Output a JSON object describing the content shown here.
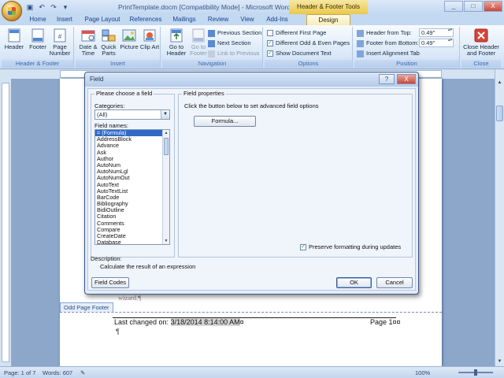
{
  "window": {
    "title": "PrintTemplate.docm [Compatibility Mode] - Microsoft Word",
    "context_tab_title": "Header & Footer Tools",
    "controls": [
      "_",
      "□",
      "X"
    ]
  },
  "tabs": [
    "Home",
    "Insert",
    "Page Layout",
    "References",
    "Mailings",
    "Review",
    "View",
    "Add-Ins",
    "Design"
  ],
  "active_tab": "Design",
  "ribbon": {
    "header_footer": {
      "label": "Header & Footer",
      "header": "Header",
      "footer": "Footer",
      "page_number": "Page Number"
    },
    "insert": {
      "label": "Insert",
      "date_time": "Date & Time",
      "quick_parts": "Quick Parts",
      "picture": "Picture",
      "clip_art": "Clip Art"
    },
    "navigation": {
      "label": "Navigation",
      "goto_header": "Go to Header",
      "goto_footer": "Go to Footer",
      "previous_section": "Previous Section",
      "next_section": "Next Section",
      "link_to_previous": "Link to Previous"
    },
    "options": {
      "label": "Options",
      "different_first_page": "Different First Page",
      "different_odd_even": "Different Odd & Even Pages",
      "show_document_text": "Show Document Text",
      "different_first_page_checked": false,
      "different_odd_even_checked": true,
      "show_document_text_checked": true
    },
    "position": {
      "label": "Position",
      "header_from_top": "Header from Top:",
      "header_from_top_value": "0.49\"",
      "footer_from_bottom": "Footer from Bottom:",
      "footer_from_bottom_value": "0.49\"",
      "insert_alignment_tab": "Insert Alignment Tab"
    },
    "close": {
      "label": "Close",
      "close_header_footer": "Close Header and Footer"
    }
  },
  "document": {
    "wizard_text": "wizard.¶",
    "odd_page_footer_tab": "Odd Page Footer",
    "footer_left_prefix": "Last changed on: ",
    "footer_left_field": "3/18/2014 8:14:00 AM",
    "footer_left_suffix": "¤",
    "footer_right": "Page 1¤¤",
    "pilcrow": "¶"
  },
  "dialog": {
    "title": "Field",
    "help": "?",
    "close": "X",
    "choose_field": "Please choose a field",
    "categories_label": "Categories:",
    "categories_value": "(All)",
    "field_names_label": "Field names:",
    "field_names": [
      "= (Formula)",
      "AddressBlock",
      "Advance",
      "Ask",
      "Author",
      "AutoNum",
      "AutoNumLgl",
      "AutoNumOut",
      "AutoText",
      "AutoTextList",
      "BarCode",
      "Bibliography",
      "BidiOutline",
      "Citation",
      "Comments",
      "Compare",
      "CreateDate",
      "Database"
    ],
    "selected_field": "= (Formula)",
    "field_properties": "Field properties",
    "properties_hint": "Click the button below to set advanced field options",
    "formula_button": "Formula...",
    "preserve_label": "Preserve formatting during updates",
    "preserve_checked": true,
    "description_label": "Description:",
    "description_text": "Calculate the result of an expression",
    "field_codes_button": "Field Codes",
    "ok_button": "OK",
    "cancel_button": "Cancel"
  },
  "status": {
    "page": "Page: 1 of 7",
    "words": "Words: 607",
    "zoom": "100%"
  }
}
